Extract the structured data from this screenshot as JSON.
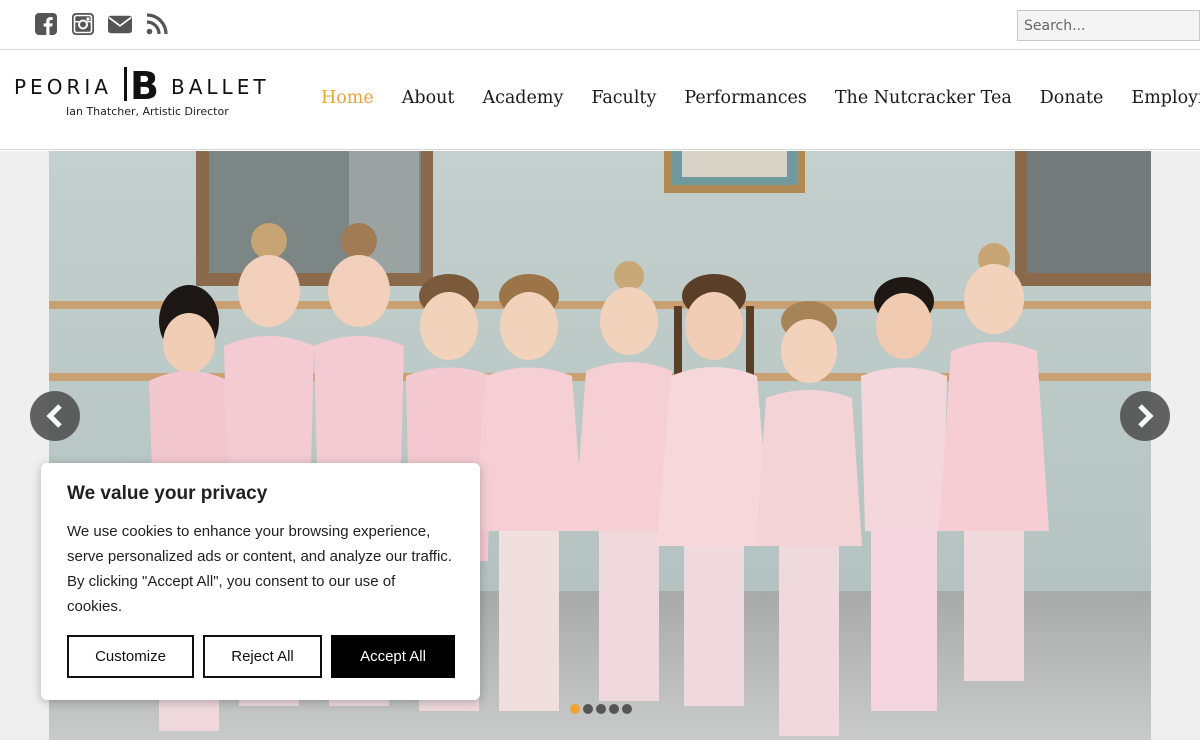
{
  "topbar": {
    "social_icons": [
      "facebook-icon",
      "instagram-icon",
      "email-icon",
      "rss-icon"
    ],
    "search": {
      "placeholder": "Search...",
      "value": ""
    }
  },
  "brand": {
    "name_left": "PEORIA",
    "name_right": "BALLET",
    "monogram": "B",
    "subtitle": "Ian Thatcher, Artistic Director"
  },
  "nav": {
    "items": [
      {
        "label": "Home",
        "active": true
      },
      {
        "label": "About",
        "active": false
      },
      {
        "label": "Academy",
        "active": false
      },
      {
        "label": "Faculty",
        "active": false
      },
      {
        "label": "Performances",
        "active": false
      },
      {
        "label": "The Nutcracker Tea",
        "active": false
      },
      {
        "label": "Donate",
        "active": false
      },
      {
        "label": "Employment",
        "active": false
      }
    ],
    "active_color": "#e8a33a"
  },
  "slider": {
    "image": "group of young ballet students in pink leotards in a dance studio",
    "prev_icon": "chevron-left-icon",
    "next_icon": "chevron-right-icon",
    "slide_count": 5,
    "active_slide": 1,
    "dot_active_color": "#f0a330"
  },
  "cookie": {
    "title": "We value your privacy",
    "body": "We use cookies to enhance your browsing experience, serve personalized ads or content, and analyze our traffic. By clicking \"Accept All\", you consent to our use of cookies.",
    "buttons": {
      "customize": "Customize",
      "reject": "Reject All",
      "accept": "Accept All"
    }
  }
}
